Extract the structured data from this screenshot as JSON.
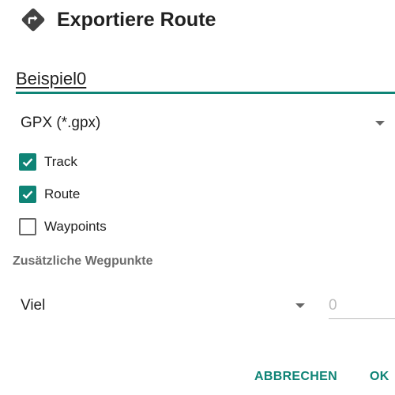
{
  "dialog": {
    "title": "Exportiere Route",
    "title_icon": "route-directions-icon"
  },
  "name_input": {
    "value": "Beispiel0"
  },
  "format_select": {
    "selected": "GPX (*.gpx)"
  },
  "options": [
    {
      "label": "Track",
      "checked": true
    },
    {
      "label": "Route",
      "checked": true
    },
    {
      "label": "Waypoints",
      "checked": false
    }
  ],
  "additional_waypoints": {
    "label": "Zusätzliche Wegpunkte",
    "amount_selected": "Viel",
    "count_value": "0"
  },
  "buttons": {
    "cancel": "ABBRECHEN",
    "ok": "OK"
  },
  "colors": {
    "accent": "#0f8476",
    "text": "#212121",
    "secondary_text": "#6b6b6b",
    "disabled_text": "#bdbdbd"
  }
}
